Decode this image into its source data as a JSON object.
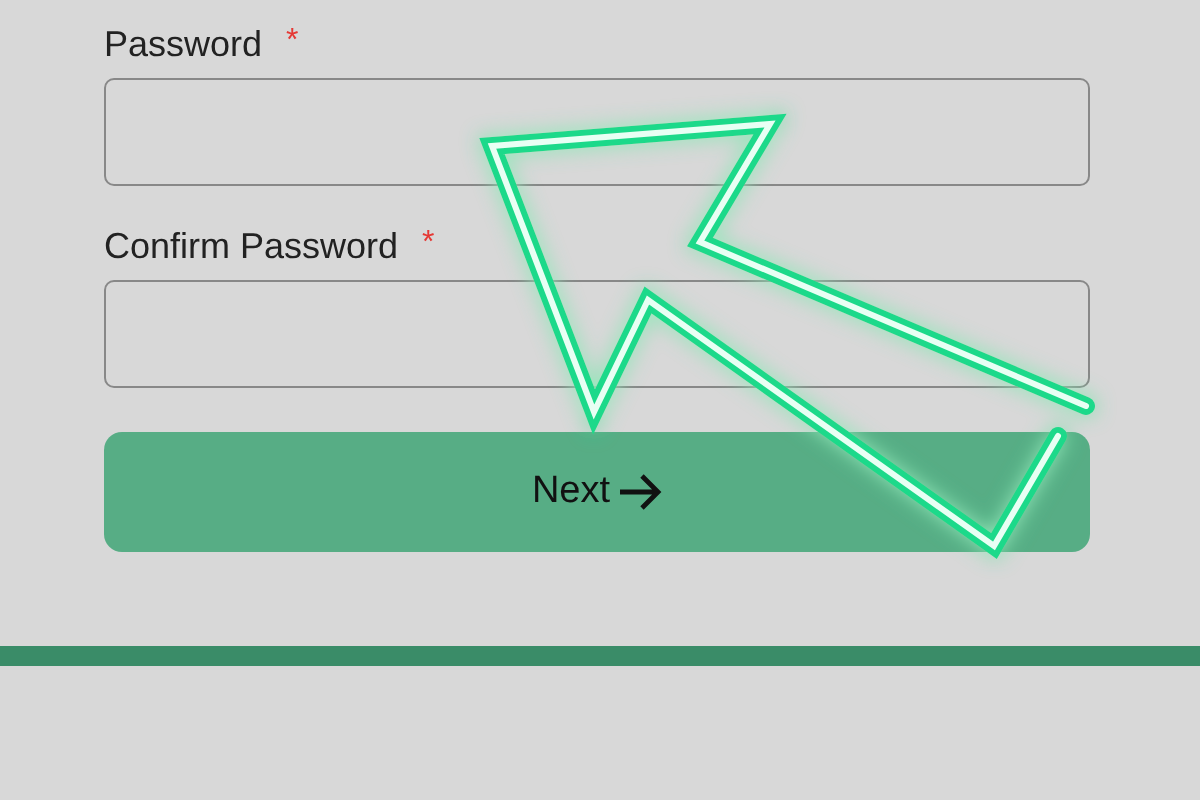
{
  "fields": [
    {
      "label": "Password",
      "required_mark": "*"
    },
    {
      "label": "Confirm Password",
      "required_mark": "*"
    }
  ],
  "button": {
    "label": "Next"
  }
}
